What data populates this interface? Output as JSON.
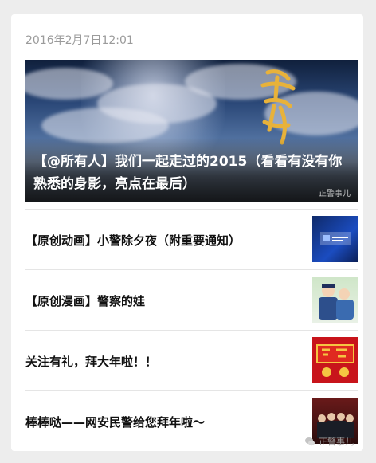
{
  "post": {
    "timestamp": "2016年2月7日12:01",
    "hero": {
      "headline": "【@所有人】我们一起走过的2015（看看有没有你熟悉的身影，亮点在最后）",
      "watermark": "正警事儿"
    },
    "items": [
      {
        "title": "【原创动画】小警除夕夜（附重要通知）",
        "thumb_icon": "police-animation-thumbnail"
      },
      {
        "title": "【原创漫画】警察的娃",
        "thumb_icon": "police-comic-thumbnail"
      },
      {
        "title": "关注有礼，拜大年啦！！",
        "thumb_icon": "new-year-card-thumbnail"
      },
      {
        "title": "棒棒哒——网安民警给您拜年啦～",
        "thumb_icon": "police-group-photo-thumbnail"
      }
    ]
  },
  "watermark": {
    "text": "正警事儿"
  },
  "colors": {
    "background": "#ededed",
    "card": "#ffffff",
    "timestamp": "#9b9b9b",
    "divider": "#e5e5e5"
  }
}
